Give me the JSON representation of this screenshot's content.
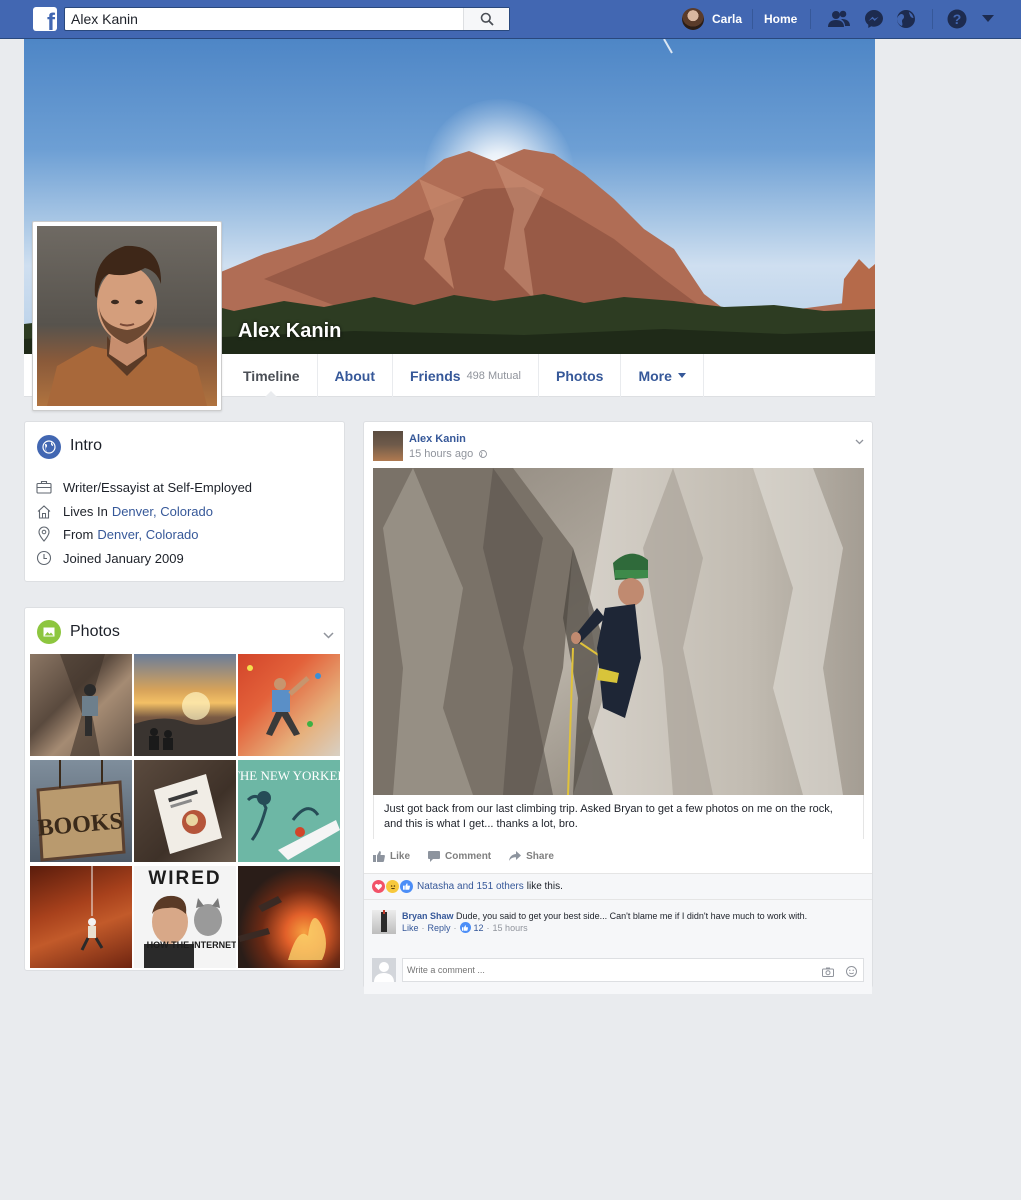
{
  "topbar": {
    "search_value": "Alex Kanin",
    "user_name": "Carla",
    "home_label": "Home",
    "brand_color": "#4267b2"
  },
  "profile": {
    "name": "Alex Kanin",
    "tabs": [
      {
        "label": "Timeline"
      },
      {
        "label": "About"
      },
      {
        "label": "Friends",
        "sub": "498 Mutual"
      },
      {
        "label": "Photos"
      },
      {
        "label": "More"
      }
    ]
  },
  "intro": {
    "title": "Intro",
    "work": "Writer/Essayist at Self-Employed",
    "lives_prefix": "Lives In",
    "lives_place": "Denver, Colorado",
    "from_prefix": "From",
    "from_place": "Denver, Colorado",
    "joined": "Joined January 2009"
  },
  "photos": {
    "title": "Photos",
    "tiles": [
      {
        "name": "climber-in-crack",
        "colors": [
          "#6b5a4c",
          "#a58b73"
        ]
      },
      {
        "name": "sunset-over-hills",
        "colors": [
          "#f0a13a",
          "#3c3b3a"
        ]
      },
      {
        "name": "climbing-gym-wall",
        "colors": [
          "#d2452a",
          "#e6b07c"
        ]
      },
      {
        "name": "books-sign",
        "colors": [
          "#5f6b7a",
          "#8c6b4c"
        ]
      },
      {
        "name": "cookbook-on-table",
        "colors": [
          "#4c3f35",
          "#8a7a6b"
        ]
      },
      {
        "name": "new-yorker-cover",
        "colors": [
          "#6db7a5",
          "#2c6e7a"
        ]
      },
      {
        "name": "rappelling-red-rock",
        "colors": [
          "#8a2d14",
          "#c25a2a"
        ]
      },
      {
        "name": "wired-cover",
        "colors": [
          "#f4f4f4",
          "#1d1d1d"
        ]
      },
      {
        "name": "campfire",
        "colors": [
          "#2a1d18",
          "#e2602a"
        ]
      }
    ],
    "newyorker_title": "THE NEW YORKER",
    "wired_title": "WIRED",
    "wired_headline": "HOW THE INTERNET SAVED",
    "books_sign": "BOOKS"
  },
  "post": {
    "author": "Alex Kanin",
    "time": "15 hours ago",
    "text": "Just got back from our last climbing trip. Asked Bryan to get a few photos on me on the rock, and this is what I get... thanks a lot, bro.",
    "actions": {
      "like": "Like",
      "comment": "Comment",
      "share": "Share"
    },
    "reactions": {
      "names": "Natasha and 151 others",
      "suffix": "like this."
    },
    "comment": {
      "author": "Bryan Shaw",
      "text": "Dude, you said to get your best side... Can't blame me if I didn't have much to work with.",
      "like": "Like",
      "reply": "Reply",
      "like_count": "12",
      "time": "15 hours"
    },
    "write_placeholder": "Write a comment ..."
  }
}
